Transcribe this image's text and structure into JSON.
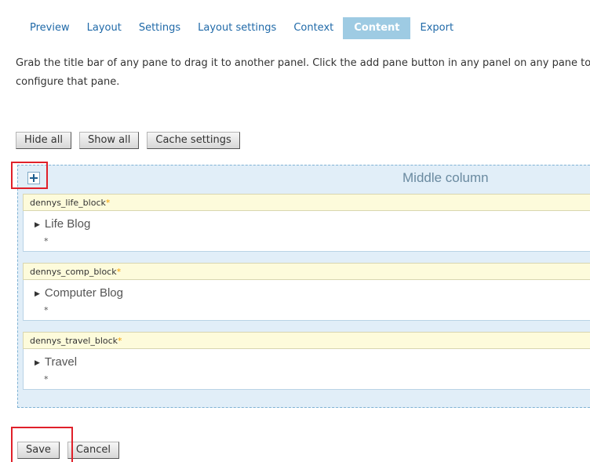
{
  "tabs": [
    {
      "label": "Preview"
    },
    {
      "label": "Layout"
    },
    {
      "label": "Settings"
    },
    {
      "label": "Layout settings"
    },
    {
      "label": "Context"
    },
    {
      "label": "Content"
    },
    {
      "label": "Export"
    }
  ],
  "active_tab": "Content",
  "help_text": "Grab the title bar of any pane to drag it to another panel. Click the add pane button in any panel on any pane to re-configure that pane.",
  "toolbar": {
    "hide_all": "Hide all",
    "show_all": "Show all",
    "cache_settings": "Cache settings"
  },
  "panel": {
    "title": "Middle column",
    "add_icon": "plus-icon",
    "panes": [
      {
        "name": "dennys_life_block",
        "marker": "*",
        "title": "Life Blog",
        "extra": "*"
      },
      {
        "name": "dennys_comp_block",
        "marker": "*",
        "title": "Computer Blog",
        "extra": "*"
      },
      {
        "name": "dennys_travel_block",
        "marker": "*",
        "title": "Travel",
        "extra": "*"
      }
    ]
  },
  "footer": {
    "save": "Save",
    "cancel": "Cancel"
  },
  "colors": {
    "tab_link": "#1f69a8",
    "active_tab_bg": "#9ecbe3",
    "panel_bg": "#e1eef8",
    "pane_header_bg": "#fdfbdb",
    "highlight": "#e0202a"
  }
}
